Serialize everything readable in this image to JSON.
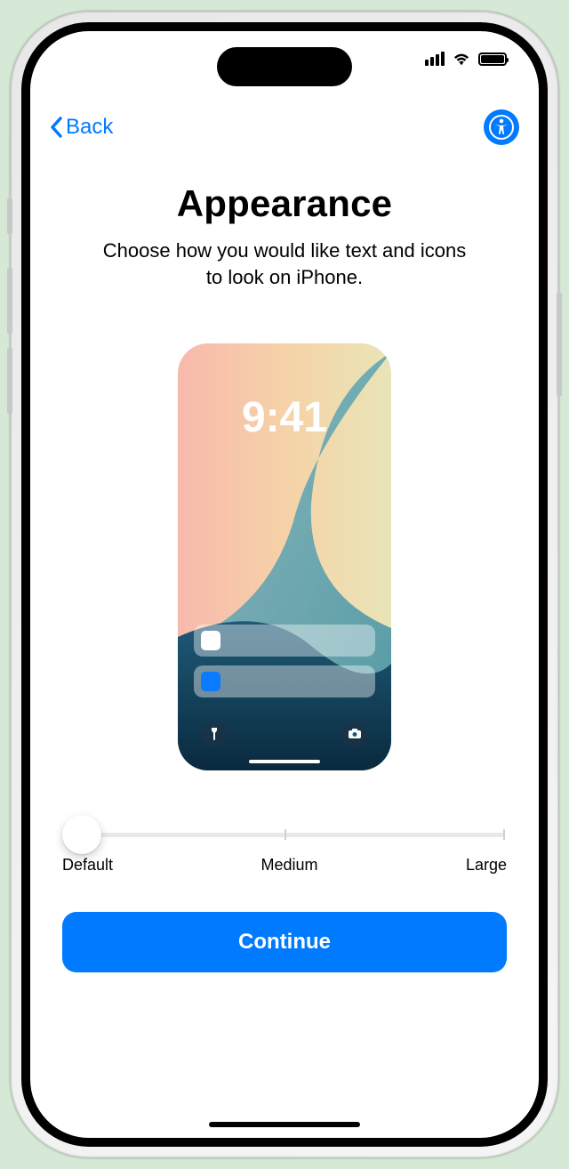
{
  "nav": {
    "back_label": "Back"
  },
  "header": {
    "title": "Appearance",
    "subtitle": "Choose how you would like text and icons to look on iPhone."
  },
  "preview": {
    "time": "9:41"
  },
  "slider": {
    "labels": {
      "default": "Default",
      "medium": "Medium",
      "large": "Large"
    },
    "selected": "Default"
  },
  "footer": {
    "continue_label": "Continue"
  }
}
